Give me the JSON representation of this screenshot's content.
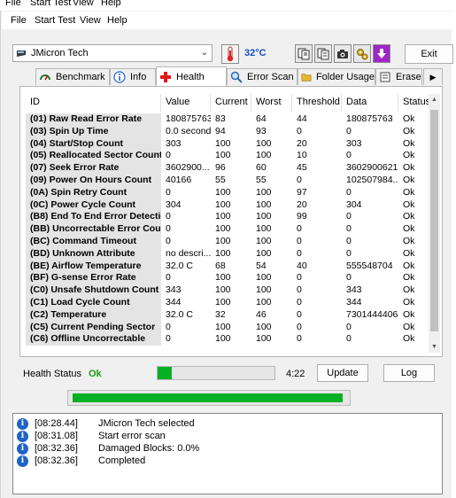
{
  "ghost_menu": [
    "File",
    "Start Test",
    "View",
    "Help"
  ],
  "menu": [
    "File",
    "Start Test",
    "View",
    "Help"
  ],
  "drive": "JMicron Tech",
  "temperature": "32°C",
  "exit_label": "Exit",
  "tabs": [
    "Benchmark",
    "Info",
    "Health",
    "Error Scan",
    "Folder Usage",
    "Erase"
  ],
  "columns": [
    "ID",
    "Value",
    "Current",
    "Worst",
    "Threshold",
    "Data",
    "Status"
  ],
  "rows": [
    [
      "(01) Raw Read Error Rate",
      "180875763",
      "83",
      "64",
      "44",
      "180875763",
      "Ok"
    ],
    [
      "(03) Spin Up Time",
      "0.0 seconds",
      "94",
      "93",
      "0",
      "0",
      "Ok"
    ],
    [
      "(04) Start/Stop Count",
      "303",
      "100",
      "100",
      "20",
      "303",
      "Ok"
    ],
    [
      "(05) Reallocated Sector Count",
      "0",
      "100",
      "100",
      "10",
      "0",
      "Ok"
    ],
    [
      "(07) Seek Error Rate",
      "3602900...",
      "96",
      "60",
      "45",
      "3602900621",
      "Ok"
    ],
    [
      "(09) Power On Hours Count",
      "40166",
      "55",
      "55",
      "0",
      "102507984...",
      "Ok"
    ],
    [
      "(0A) Spin Retry Count",
      "0",
      "100",
      "100",
      "97",
      "0",
      "Ok"
    ],
    [
      "(0C) Power Cycle Count",
      "304",
      "100",
      "100",
      "20",
      "304",
      "Ok"
    ],
    [
      "(B8) End To End Error Detection",
      "0",
      "100",
      "100",
      "99",
      "0",
      "Ok"
    ],
    [
      "(BB) Uncorrectable Error Count",
      "0",
      "100",
      "100",
      "0",
      "0",
      "Ok"
    ],
    [
      "(BC) Command Timeout",
      "0",
      "100",
      "100",
      "0",
      "0",
      "Ok"
    ],
    [
      "(BD) Unknown Attribute",
      "no descri...",
      "100",
      "100",
      "0",
      "0",
      "Ok"
    ],
    [
      "(BE) Airflow Temperature",
      "32.0 C",
      "68",
      "54",
      "40",
      "555548704",
      "Ok"
    ],
    [
      "(BF) G-sense Error Rate",
      "0",
      "100",
      "100",
      "0",
      "0",
      "Ok"
    ],
    [
      "(C0) Unsafe Shutdown Count",
      "343",
      "100",
      "100",
      "0",
      "343",
      "Ok"
    ],
    [
      "(C1) Load Cycle Count",
      "344",
      "100",
      "100",
      "0",
      "344",
      "Ok"
    ],
    [
      "(C2) Temperature",
      "32.0 C",
      "32",
      "46",
      "0",
      "73014444064",
      "Ok"
    ],
    [
      "(C5) Current Pending Sector",
      "0",
      "100",
      "100",
      "0",
      "0",
      "Ok"
    ],
    [
      "(C6) Offline Uncorrectable",
      "0",
      "100",
      "100",
      "0",
      "0",
      "Ok"
    ]
  ],
  "health": {
    "label": "Health Status",
    "value": "Ok",
    "progress": 0.12,
    "time": "4:22",
    "update_label": "Update",
    "log_label": "Log"
  },
  "overall_progress": 1.0,
  "log": [
    {
      "time": "[08:28.44]",
      "msg": "JMicron Tech selected"
    },
    {
      "time": "[08:31.08]",
      "msg": "Start error scan"
    },
    {
      "time": "[08:32.36]",
      "msg": "Damaged Blocks: 0.0%"
    },
    {
      "time": "[08:32.36]",
      "msg": "Completed"
    }
  ],
  "colors": {
    "accent_green": "#06b025",
    "status_ok": "#1a9a1a",
    "temp_blue": "#1050c8",
    "info_blue": "#1f63c9"
  }
}
